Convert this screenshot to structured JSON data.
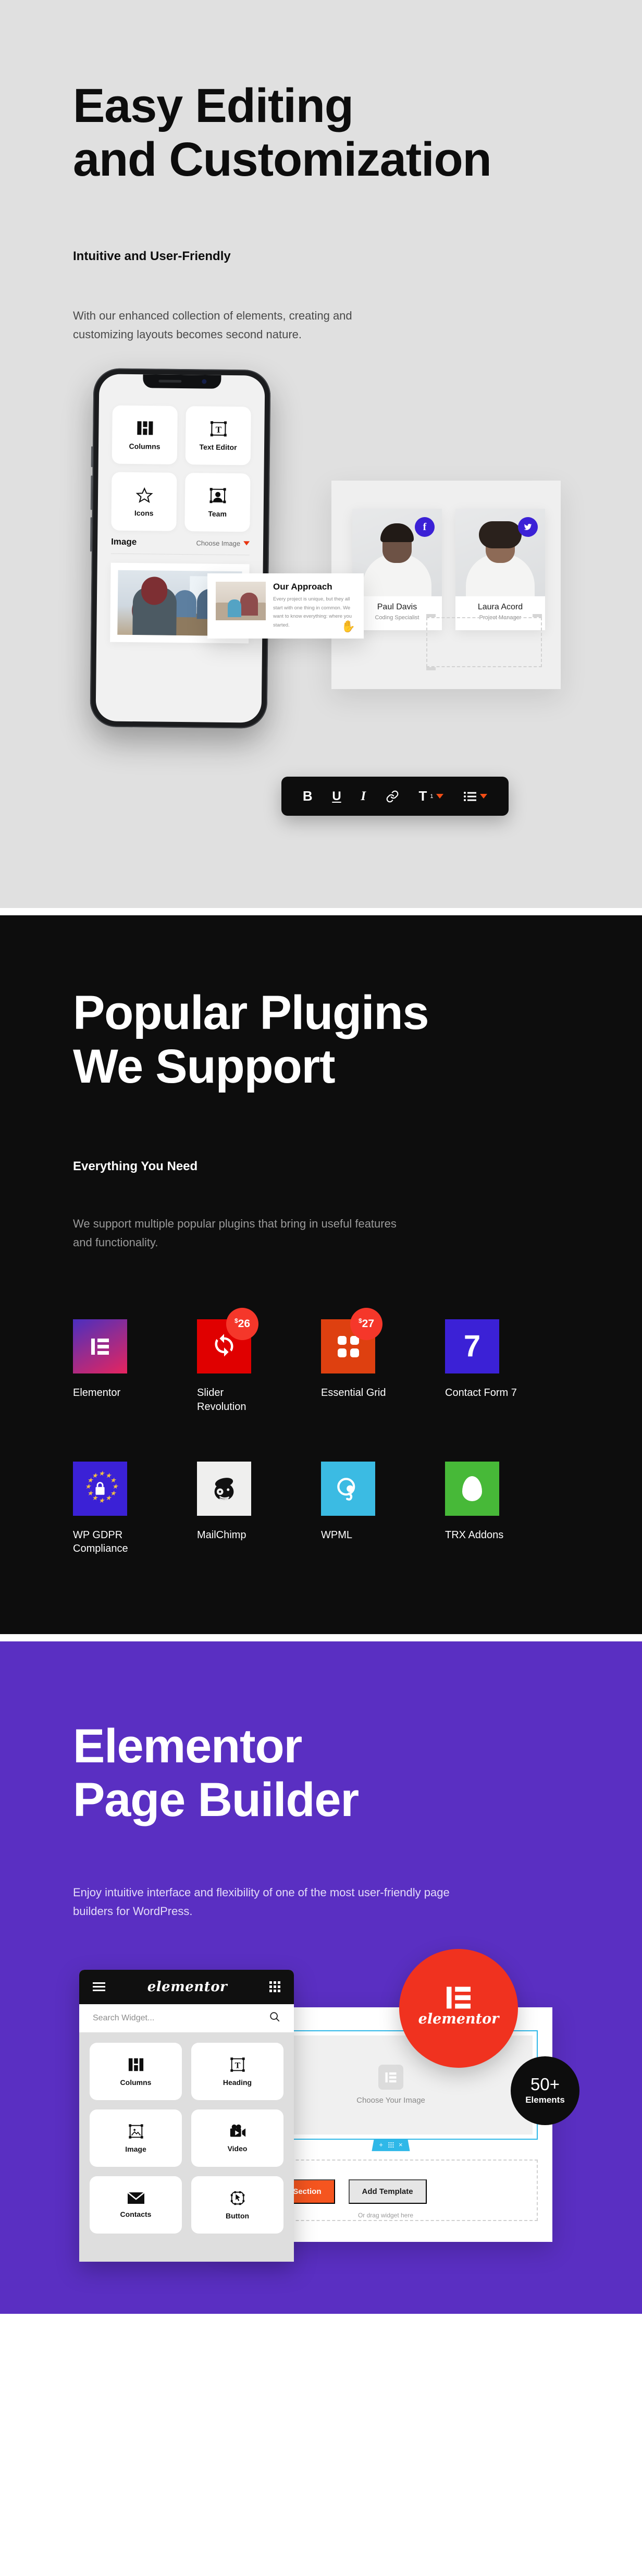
{
  "section_editing": {
    "heading_line1": "Easy Editing",
    "heading_line2": "and Customization",
    "eyebrow": "Intuitive and User-Friendly",
    "lede": "With our enhanced collection of elements, creating and customizing layouts becomes second nature.",
    "toolbar": {
      "bold": "B",
      "underline": "U",
      "italic": "I",
      "link_icon": "link-icon",
      "text_size": "T",
      "text_size_sub": "1",
      "list_icon": "bulleted-list-icon",
      "dropdown_icon": "caret-down-icon"
    },
    "phone_widgets": [
      {
        "label": "Columns",
        "icon": "columns-icon"
      },
      {
        "label": "Text Editor",
        "icon": "text-editor-icon"
      },
      {
        "label": "Icons",
        "icon": "star-icon"
      },
      {
        "label": "Team",
        "icon": "team-icon"
      }
    ],
    "image_row": {
      "label": "Image",
      "choose": "Choose Image",
      "caret": "caret-down-icon"
    },
    "team": [
      {
        "name": "Paul Davis",
        "role": "Coding Specialist",
        "social": "f",
        "social_name": "facebook-icon"
      },
      {
        "name": "Laura Acord",
        "role": "Project Manager",
        "social": "t",
        "social_name": "twitter-icon"
      }
    ],
    "approach_card": {
      "title": "Our Approach",
      "text": "Every project is unique, but they all start with one thing in common. We want to know everything: where you started.",
      "cursor": "hand-cursor"
    }
  },
  "section_plugins": {
    "heading_line1": "Popular Plugins",
    "heading_line2": "We Support",
    "eyebrow": "Everything You Need",
    "lede": "We support multiple popular plugins that bring in useful features and functionality.",
    "items": [
      {
        "name": "Elementor",
        "icon": "elementor-icon",
        "badge": "",
        "badge_currency": ""
      },
      {
        "name": "Slider Revolution",
        "icon": "refresh-icon",
        "badge": "26",
        "badge_currency": "$"
      },
      {
        "name": "Essential Grid",
        "icon": "grid-4-icon",
        "badge": "27",
        "badge_currency": "$"
      },
      {
        "name": "Contact Form 7",
        "icon": "number-7-icon",
        "badge": "",
        "badge_currency": ""
      },
      {
        "name": "WP GDPR Compliance",
        "icon": "eu-lock-icon",
        "badge": "",
        "badge_currency": ""
      },
      {
        "name": "MailChimp",
        "icon": "mailchimp-monkey-icon",
        "badge": "",
        "badge_currency": ""
      },
      {
        "name": "WPML",
        "icon": "wpml-icon",
        "badge": "",
        "badge_currency": ""
      },
      {
        "name": "TRX Addons",
        "icon": "egg-icon",
        "badge": "",
        "badge_currency": ""
      }
    ],
    "cf7_glyph": "7"
  },
  "section_builder": {
    "heading_line1": "Elementor",
    "heading_line2": "Page Builder",
    "lede": "Enjoy intuitive interface and flexibility of one of the most user-friendly page builders for WordPress.",
    "panel": {
      "menu_icon": "hamburger-icon",
      "logo": "elementor",
      "apps_icon": "grid-apps-icon",
      "search_placeholder": "Search Widget...",
      "search_icon": "search-icon",
      "widgets": [
        {
          "label": "Columns",
          "icon": "columns-icon"
        },
        {
          "label": "Heading",
          "icon": "heading-icon"
        },
        {
          "label": "Image",
          "icon": "image-icon"
        },
        {
          "label": "Video",
          "icon": "video-camera-icon"
        },
        {
          "label": "Contacts",
          "icon": "envelope-icon"
        },
        {
          "label": "Button",
          "icon": "button-icon"
        }
      ]
    },
    "canvas": {
      "placeholder_text": "Choose Your Image",
      "placeholder_icon": "elementor-icon",
      "section_tools": {
        "add": "+",
        "drag": "drag-handle-icon",
        "remove": "×"
      },
      "add_section_button": "Add New Section",
      "add_template_button": "Add Template",
      "drag_hint": "Or drag widget here"
    },
    "badge_elementor": {
      "icon": "elementor-icon",
      "script": "elementor"
    },
    "badge_elements": {
      "count": "50+",
      "label": "Elements"
    }
  },
  "colors": {
    "editing_bg": "#e0e0e0",
    "plugins_bg": "#0d0d0d",
    "builder_bg": "#5a2fc2",
    "accent_orange": "#f5551f",
    "accent_red": "#f0321f",
    "accent_blue": "#2fb8e8",
    "badge_red": "#f5372a",
    "social_blue": "#3b21d6"
  }
}
